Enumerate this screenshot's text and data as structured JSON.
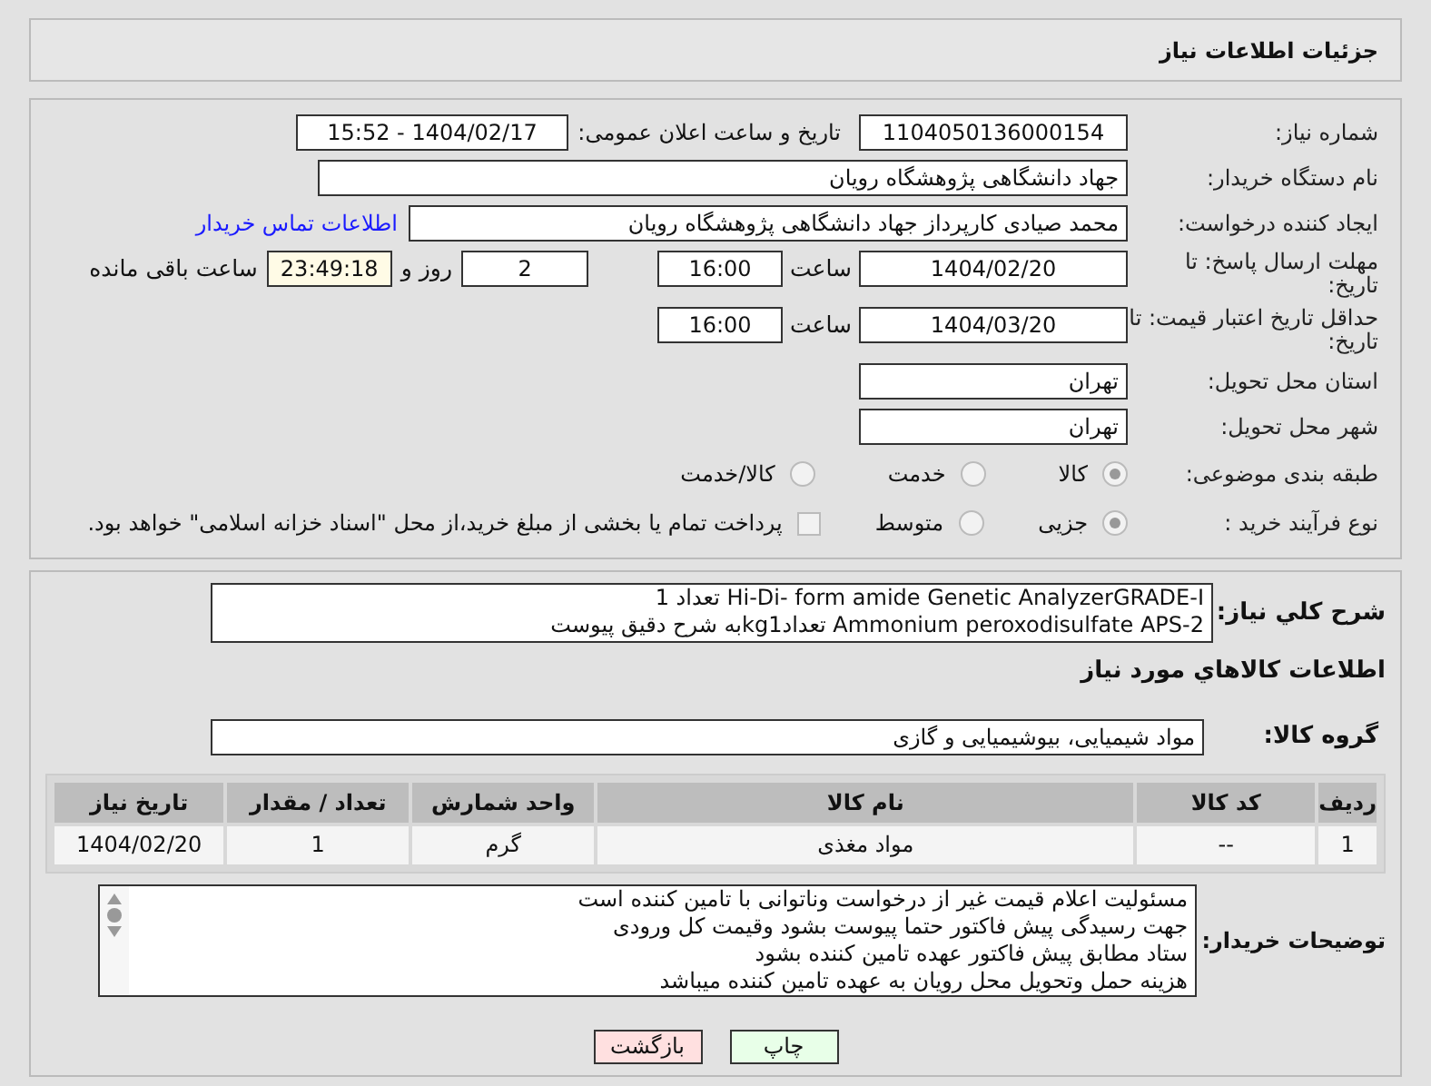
{
  "header": {
    "title": "جزئیات اطلاعات نیاز"
  },
  "need_number": {
    "label": "شماره نیاز:",
    "value": "1104050136000154"
  },
  "announce": {
    "label": "تاریخ و ساعت اعلان عمومی:",
    "value": "1404/02/17 - 15:52"
  },
  "buyer_org": {
    "label": "نام دستگاه خریدار:",
    "value": "جهاد دانشگاهی پژوهشگاه رویان"
  },
  "requester": {
    "label": "ایجاد کننده درخواست:",
    "value": "محمد صیادی کارپرداز جهاد دانشگاهی پژوهشگاه رویان",
    "link": "اطلاعات تماس خریدار"
  },
  "deadline": {
    "label": "مهلت ارسال پاسخ: تا تاریخ:",
    "date": "1404/02/20",
    "time_label": "ساعت",
    "time": "16:00",
    "days": "2",
    "days_label": "روز و",
    "remaining": "23:49:18",
    "remaining_label": "ساعت باقی مانده"
  },
  "validity": {
    "label": "حداقل تاریخ اعتبار قیمت: تا تاریخ:",
    "date": "1404/03/20",
    "time_label": "ساعت",
    "time": "16:00"
  },
  "province": {
    "label": "استان محل تحویل:",
    "value": "تهران"
  },
  "city": {
    "label": "شهر محل تحویل:",
    "value": "تهران"
  },
  "category": {
    "label": "طبقه بندی موضوعی:",
    "options": [
      {
        "label": "کالا",
        "selected": true
      },
      {
        "label": "خدمت",
        "selected": false
      },
      {
        "label": "کالا/خدمت",
        "selected": false
      }
    ]
  },
  "purchase_type": {
    "label": "نوع فرآیند خرید :",
    "options": [
      {
        "label": "جزیی",
        "selected": true
      },
      {
        "label": "متوسط",
        "selected": false
      }
    ],
    "payment": {
      "checked": false,
      "label": "پرداخت تمام یا بخشی از مبلغ خرید،از محل \"اسناد خزانه اسلامی\" خواهد بود."
    }
  },
  "description": {
    "label": "شرح کلي نياز:",
    "lines": [
      "Hi-Di- form amide Genetic AnalyzerGRADE-I تعداد 1",
      "Ammonium peroxodisulfate APS-2  تعدادkg1به شرح دقیق پیوست"
    ]
  },
  "items_heading": "اطلاعات كالاهاي مورد نياز",
  "goods_group": {
    "label": "گروه کالا:",
    "value": "مواد شیمیایی، بیوشیمیایی و  گازی"
  },
  "table": {
    "columns": [
      "ردیف",
      "کد کالا",
      "نام کالا",
      "واحد شمارش",
      "تعداد / مقدار",
      "تاریخ نیاز"
    ],
    "rows": [
      [
        "1",
        "--",
        "مواد مغذی",
        "گرم",
        "1",
        "1404/02/20"
      ]
    ]
  },
  "buyer_notes": {
    "label": "توضیحات خریدار:",
    "lines": [
      "مسئولیت اعلام قیمت  غیر از درخواست وناتوانی با تامین کننده است",
      "جهت رسیدگی پیش فاکتور حتما پیوست بشود وقیمت کل ورودی",
      "ستاد مطابق پیش فاکتور عهده تامین کننده بشود",
      "هزینه حمل وتحویل محل رویان به عهده تامین کننده میباشد"
    ]
  },
  "buttons": [
    {
      "label": "چاپ",
      "kind": "print"
    },
    {
      "label": "بازگشت",
      "kind": "back"
    }
  ]
}
